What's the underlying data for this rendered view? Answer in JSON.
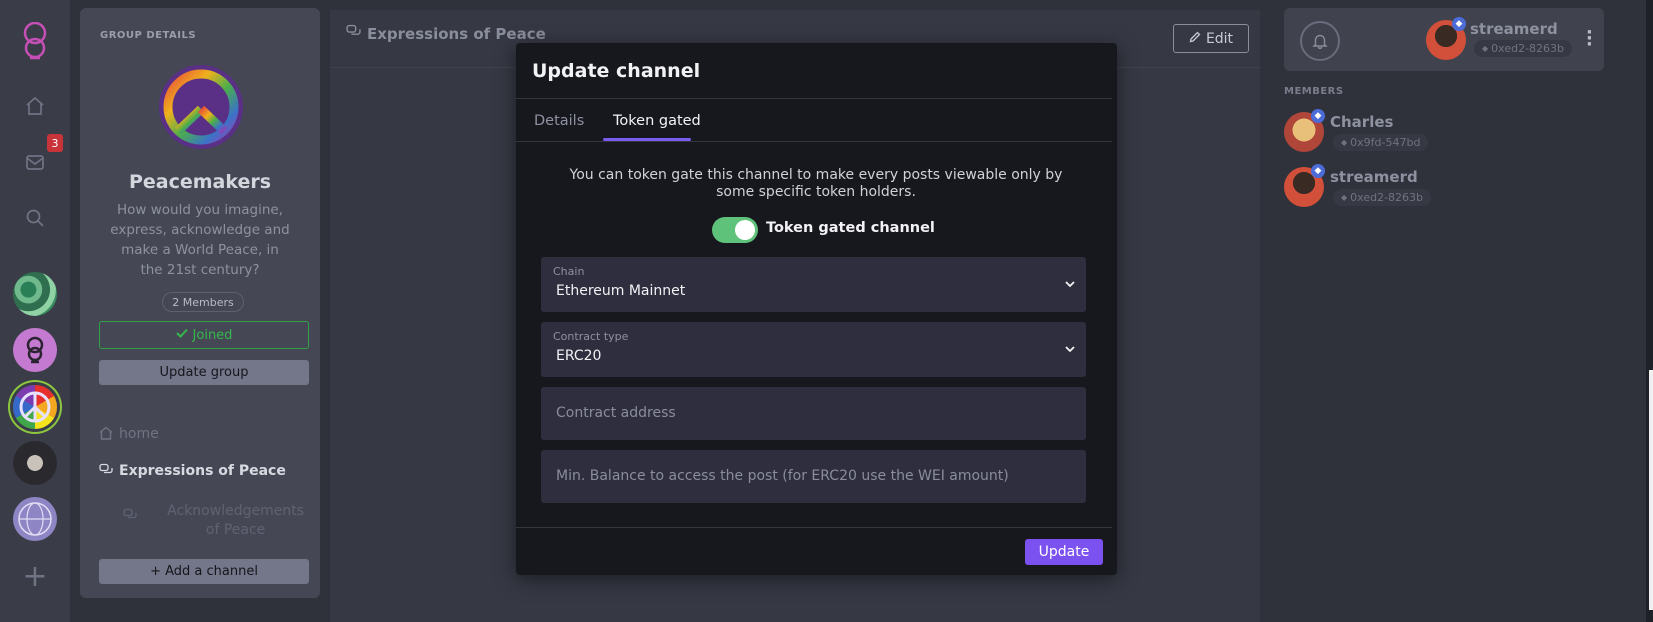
{
  "rail": {
    "badge_count": "3",
    "icons": [
      "home-icon",
      "mail-icon",
      "search-icon"
    ]
  },
  "group_panel": {
    "section_label": "GROUP DETAILS",
    "name": "Peacemakers",
    "description": "How would you imagine, express, acknowledge and make a World Peace, in the 21st century?",
    "members_count": "2 Members",
    "joined_label": "Joined",
    "update_group_label": "Update group",
    "channels": [
      {
        "label": "home"
      },
      {
        "label": "Expressions of Peace"
      },
      {
        "label": "Acknowledgements of Peace"
      }
    ],
    "add_channel_label": "+ Add a channel"
  },
  "main": {
    "channel_title": "Expressions of Peace",
    "edit_label": "Edit"
  },
  "user_card": {
    "username": "streamerd",
    "address": "0xed2-8263b"
  },
  "members": {
    "label": "MEMBERS",
    "list": [
      {
        "name": "Charles",
        "address": "0x9fd-547bd"
      },
      {
        "name": "streamerd",
        "address": "0xed2-8263b"
      }
    ]
  },
  "modal": {
    "title": "Update channel",
    "tabs": [
      {
        "label": "Details"
      },
      {
        "label": "Token gated"
      }
    ],
    "info": "You can token gate this channel to make every posts viewable only by some specific token holders.",
    "toggle_label": "Token gated channel",
    "toggle_on": true,
    "chain": {
      "label": "Chain",
      "value": "Ethereum Mainnet"
    },
    "contract_type": {
      "label": "Contract type",
      "value": "ERC20"
    },
    "contract_address_placeholder": "Contract address",
    "min_balance_placeholder": "Min. Balance to access the post (for ERC20 use the WEI amount)",
    "update_label": "Update"
  },
  "colors": {
    "accent": "#7b52f0",
    "toggle": "#5ec27a",
    "joined": "#34b84c",
    "badge": "#c8343a"
  }
}
